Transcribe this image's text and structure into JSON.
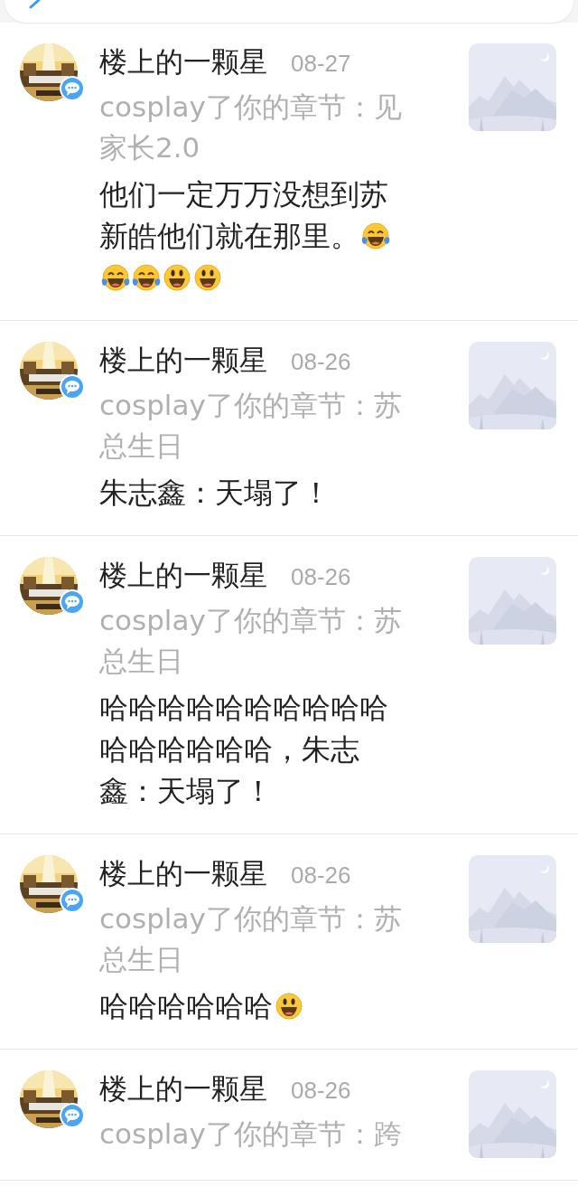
{
  "notifications": [
    {
      "user": "楼上的一颗星",
      "date": "08-27",
      "action": "cosplay了你的章节：见家长2.0",
      "comment_lines": [
        [
          {
            "kind": "text",
            "text": "他们一定万万没想到苏"
          }
        ],
        [
          {
            "kind": "text",
            "text": "新皓他们就在那里。"
          },
          {
            "kind": "laugh-cry"
          }
        ],
        [
          {
            "kind": "laugh-cry"
          },
          {
            "kind": "laugh-cry"
          },
          {
            "kind": "grin"
          },
          {
            "kind": "grin"
          }
        ]
      ]
    },
    {
      "user": "楼上的一颗星",
      "date": "08-26",
      "action": "cosplay了你的章节：苏总生日",
      "comment_lines": [
        [
          {
            "kind": "text",
            "text": "朱志鑫：天塌了！"
          }
        ]
      ]
    },
    {
      "user": "楼上的一颗星",
      "date": "08-26",
      "action": "cosplay了你的章节：苏总生日",
      "comment_lines": [
        [
          {
            "kind": "text",
            "text": "哈哈哈哈哈哈哈哈哈哈"
          }
        ],
        [
          {
            "kind": "text",
            "text": "哈哈哈哈哈哈，朱志"
          }
        ],
        [
          {
            "kind": "text",
            "text": "鑫：天塌了！"
          }
        ]
      ]
    },
    {
      "user": "楼上的一颗星",
      "date": "08-26",
      "action": "cosplay了你的章节：苏总生日",
      "comment_lines": [
        [
          {
            "kind": "text",
            "text": "哈哈哈哈哈哈"
          },
          {
            "kind": "grin"
          }
        ]
      ]
    },
    {
      "user": "楼上的一颗星",
      "date": "08-26",
      "action": "cosplay了你的章节：跨"
    }
  ]
}
